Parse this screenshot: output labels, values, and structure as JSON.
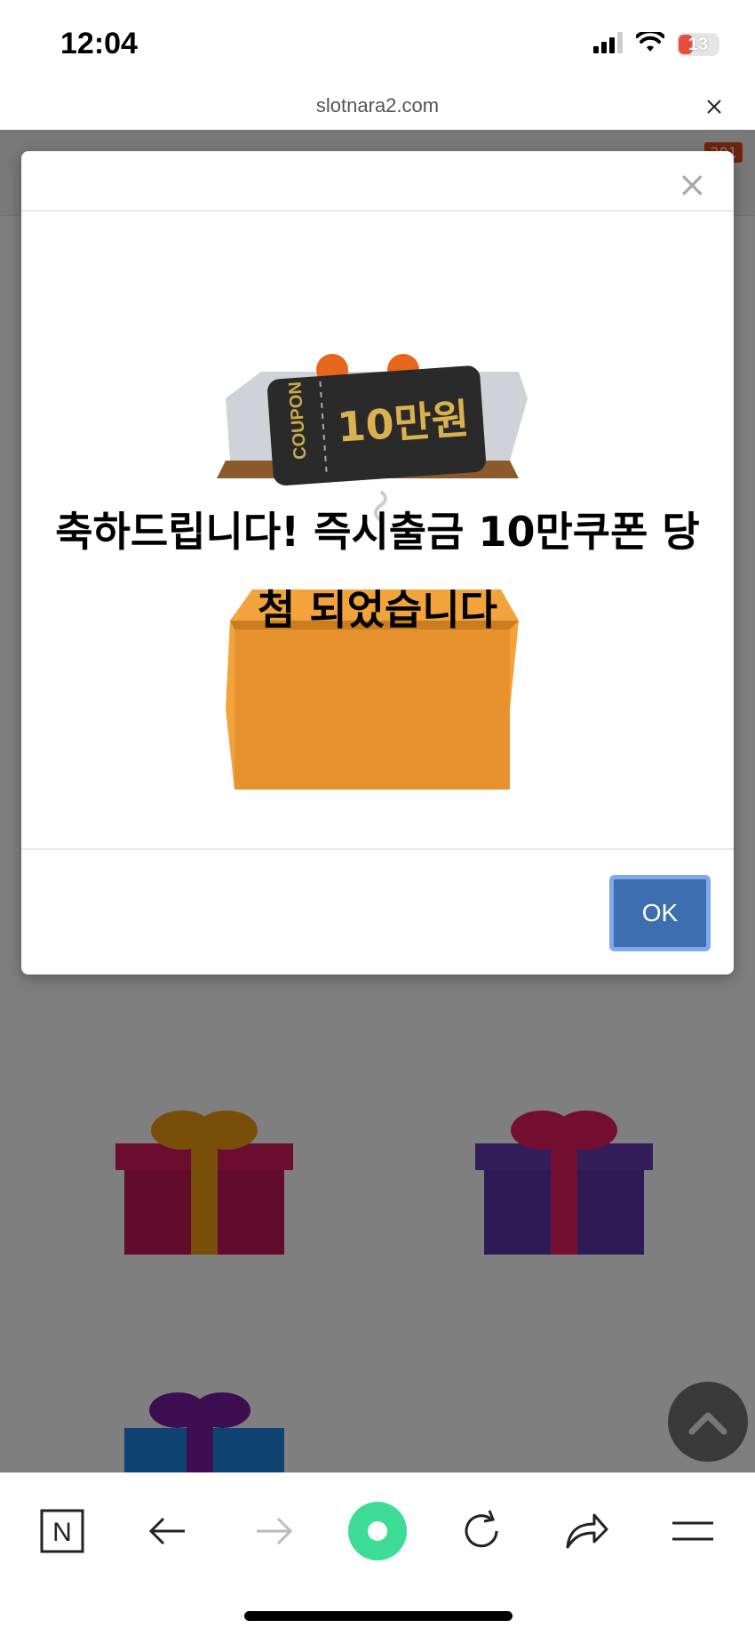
{
  "status_bar": {
    "time": "12:04",
    "battery": "13",
    "icons": [
      "signal-icon",
      "wifi-icon",
      "battery-charging-icon"
    ]
  },
  "browser": {
    "url": "slotnara2.com",
    "close_icon": "close-icon"
  },
  "page": {
    "badge": "201",
    "gifts": [
      "red-gift-box",
      "purple-gift-box",
      "blue-gift-box"
    ]
  },
  "modal": {
    "coupon_label": "COUPON",
    "coupon_amount": "10만원",
    "message": "축하드립니다! 즉시출금 10만쿠폰 당첨 되었습니다",
    "ok_label": "OK",
    "close_icon": "close-icon"
  },
  "toolbar": {
    "items": [
      "naver-icon",
      "back-arrow-icon",
      "forward-arrow-icon",
      "green-dot-icon",
      "refresh-icon",
      "share-icon",
      "menu-icon"
    ]
  },
  "colors": {
    "ok_button": "#3d6fb0",
    "ok_border": "#7ea9ee",
    "overlay": "rgba(0,0,0,0.5)"
  }
}
